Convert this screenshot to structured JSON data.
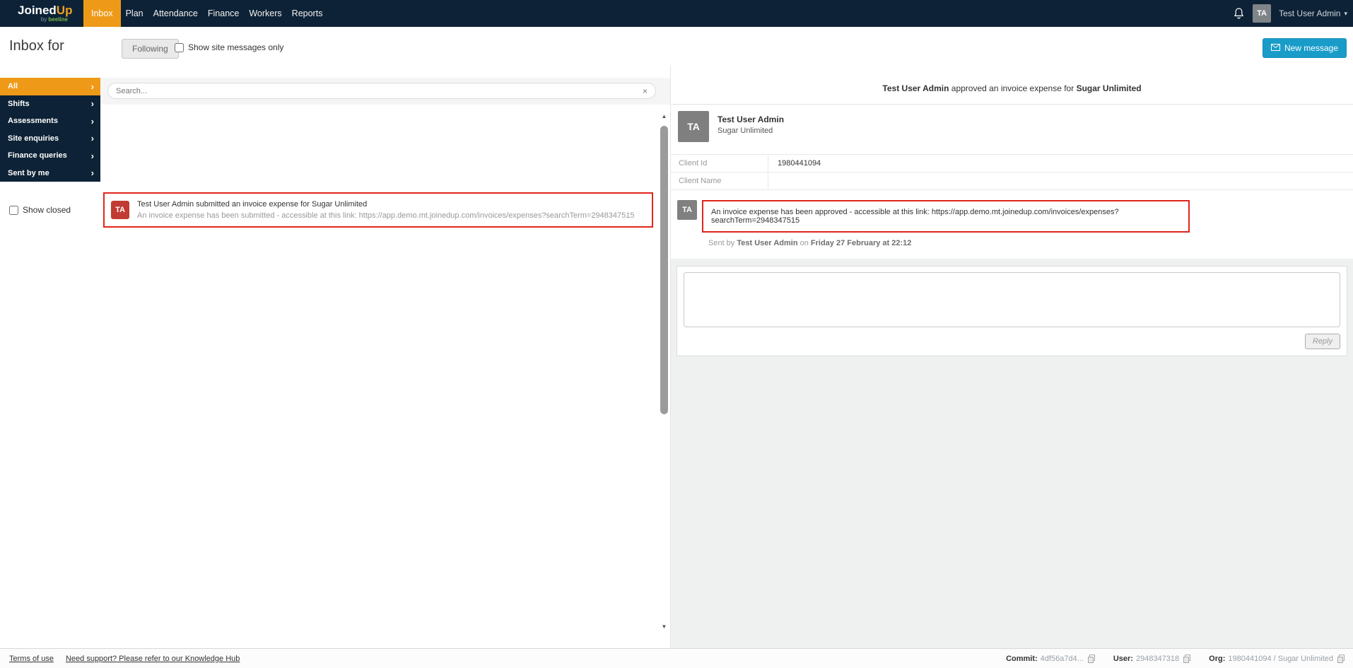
{
  "colors": {
    "navbar_navy": "#0d2236",
    "accent_orange": "#ee9a18",
    "primary_blue": "#1a9cc9",
    "highlight_red_border": "#e0251c",
    "avatar_red": "#c23b32",
    "avatar_gray": "#7f7f7f",
    "brand_green": "#7ab648"
  },
  "logo": {
    "main_left": "Joined",
    "main_right": "Up",
    "sub_prefix": "by ",
    "sub_brand": "beeline"
  },
  "navbar": {
    "items": [
      {
        "label": "Inbox",
        "active": true
      },
      {
        "label": "Plan"
      },
      {
        "label": "Attendance"
      },
      {
        "label": "Finance"
      },
      {
        "label": "Workers"
      },
      {
        "label": "Reports"
      }
    ],
    "user": {
      "initials": "TA",
      "name": "Test User Admin"
    }
  },
  "page_header": {
    "title": "Inbox for",
    "following_label": "Following",
    "show_site_label": "Show site messages only",
    "new_message_label": "New message"
  },
  "sidebar": {
    "items": [
      {
        "label": "All",
        "active": true
      },
      {
        "label": "Shifts"
      },
      {
        "label": "Assessments"
      },
      {
        "label": "Site enquiries"
      },
      {
        "label": "Finance queries"
      },
      {
        "label": "Sent by me"
      }
    ],
    "show_closed_label": "Show closed",
    "chevron": "›"
  },
  "list": {
    "search_placeholder": "Search...",
    "clear_label": "×",
    "scroll_up": "▲",
    "scroll_down": "▼",
    "items": [
      {
        "initials": "TA",
        "title": "Test User Admin submitted an invoice expense for Sugar Unlimited",
        "subtitle": "An invoice expense has been submitted - accessible at this link: https://app.demo.mt.joinedup.com/invoices/expenses?searchTerm=2948347515"
      }
    ]
  },
  "detail": {
    "title_sender": "Test User Admin",
    "title_action": " approved an invoice expense for ",
    "title_org": "Sugar Unlimited",
    "sender": {
      "initials": "TA",
      "name": "Test User Admin",
      "org": "Sugar Unlimited"
    },
    "fields": [
      {
        "label": "Client Id",
        "value": "1980441094"
      },
      {
        "label": "Client Name",
        "value": ""
      }
    ],
    "message": {
      "initials": "TA",
      "text": "An invoice expense has been approved - accessible at this link: https://app.demo.mt.joinedup.com/invoices/expenses?searchTerm=2948347515",
      "sent": {
        "prefix": "Sent by ",
        "name": "Test User Admin",
        "on": " on ",
        "date": "Friday 27 February at 22:12"
      }
    },
    "reply_label": "Reply"
  },
  "footer": {
    "terms": "Terms of use",
    "support": "Need support? Please refer to our Knowledge Hub",
    "items": [
      {
        "label": "Commit:",
        "value": "4df56a7d4..."
      },
      {
        "label": "User:",
        "value": "2948347318"
      },
      {
        "label": "Org:",
        "value": "1980441094 / Sugar Unlimited"
      }
    ]
  }
}
